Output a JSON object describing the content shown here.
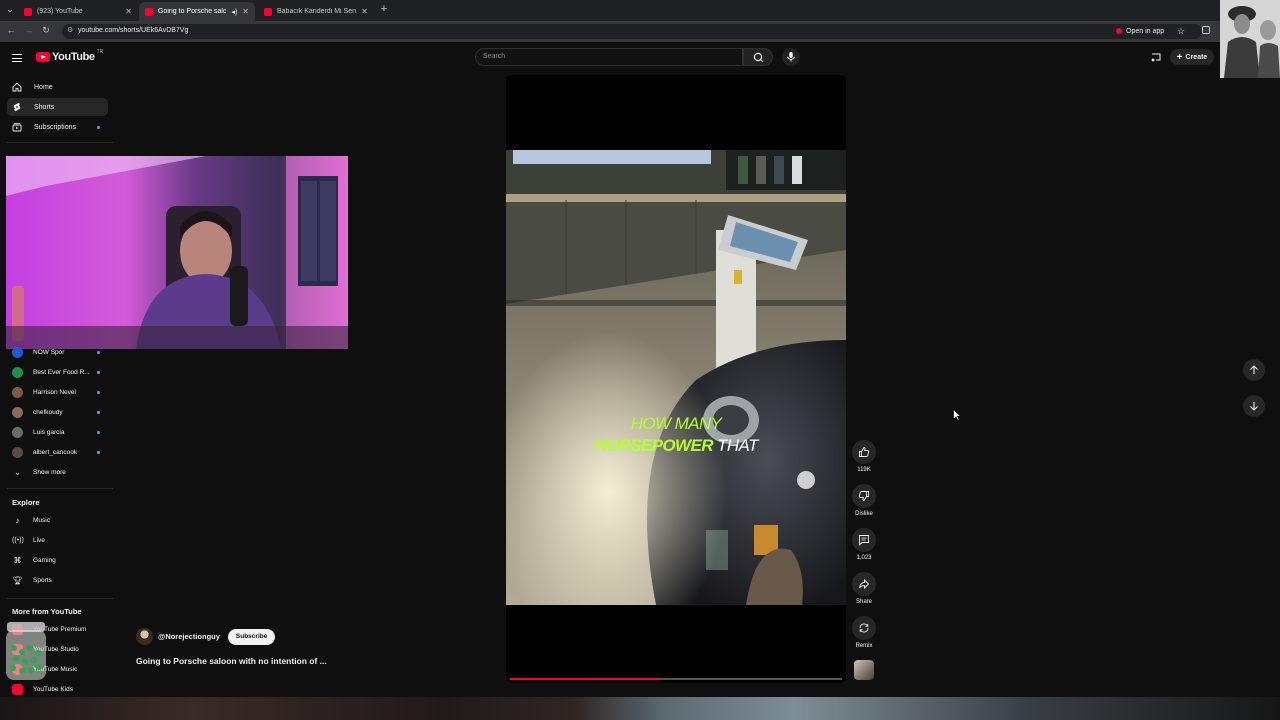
{
  "browser": {
    "tabs": [
      {
        "label": "(923) YouTube",
        "active": false
      },
      {
        "label": "Going to Porsche saloon wi",
        "active": true
      },
      {
        "label": "Babacık Kanderdi Mi Seni? - Yo",
        "active": false
      }
    ],
    "url": "youtube.com/shorts/UEk6AvDB7Vg",
    "open_in_app": "Open in app"
  },
  "masthead": {
    "logo_text": "YouTube",
    "country_code": "TR",
    "search_placeholder": "Search",
    "create_label": "Create"
  },
  "sidebar": {
    "main": [
      {
        "label": "Home",
        "icon": "home-icon"
      },
      {
        "label": "Shorts",
        "icon": "shorts-icon",
        "selected": true
      },
      {
        "label": "Subscriptions",
        "icon": "subscriptions-icon"
      }
    ],
    "subscriptions": [
      {
        "label": "NOW Spor",
        "color": "#1e5bd8"
      },
      {
        "label": "Best Ever Food R...",
        "color": "#1f8f4e"
      },
      {
        "label": "Harrison Nevel",
        "color": "#7d5a44"
      },
      {
        "label": "chefkoudy",
        "color": "#8b6b5a"
      },
      {
        "label": "Luis garcia",
        "color": "#6b6b6b"
      },
      {
        "label": "albert_cancook",
        "color": "#5b4a3e"
      }
    ],
    "show_more": "Show more",
    "explore_title": "Explore",
    "explore": [
      {
        "label": "Music",
        "icon": "music-icon"
      },
      {
        "label": "Live",
        "icon": "live-icon"
      },
      {
        "label": "Gaming",
        "icon": "gaming-icon"
      },
      {
        "label": "Sports",
        "icon": "trophy-icon"
      }
    ],
    "more_title": "More from YouTube",
    "more": [
      {
        "label": "YouTube Premium"
      },
      {
        "label": "YouTube Studio"
      },
      {
        "label": "YouTube Music"
      },
      {
        "label": "YouTube Kids"
      }
    ]
  },
  "short": {
    "caption_line1": "HOW MANY",
    "caption_highlight": "HORSEPOWER",
    "caption_rest": " THAT",
    "progress": 0.45,
    "channel": "@Norejectionguy",
    "subscribe_label": "Subscribe",
    "title": "Going to Porsche saloon with no intention of ...",
    "actions": {
      "likes": "119K",
      "dislike": "Dislike",
      "comments": "1,023",
      "share": "Share",
      "remix": "Remix"
    }
  },
  "colors": {
    "accent": "#ff0033",
    "caption_green": "#b6ff2e",
    "background": "#0f0f0f"
  }
}
